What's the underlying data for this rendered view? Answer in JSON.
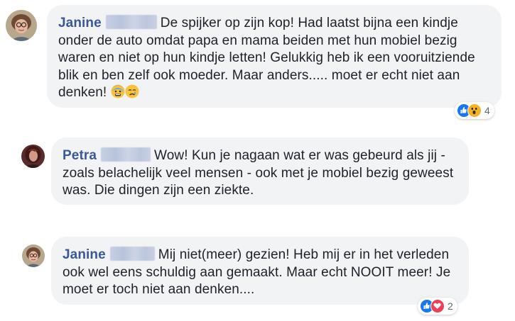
{
  "comments": [
    {
      "author": "Janine",
      "text": "De spijker op zijn kop! Had laatst bijna een kindje onder de auto omdat papa en mama beiden met hun mobiel bezig waren en niet op hun kindje letten! Gelukkig heb ik een vooruitziende blik en ben zelf ook moeder. Maar anders..... moet er echt niet aan denken!",
      "emojis": [
        "anxious-sweat-face-emoji",
        "crying-face-emoji"
      ],
      "reactions": {
        "icons": [
          "like-icon",
          "wow-icon"
        ],
        "count": "4"
      }
    },
    {
      "author": "Petra",
      "text": "Wow! Kun je nagaan wat er was gebeurd als jij - zoals belachelijk veel mensen - ook met je mobiel bezig geweest was. Die dingen zijn een ziekte."
    },
    {
      "author": "Janine",
      "text": "Mij niet(meer) gezien! Heb mij er in het verleden ook wel eens schuldig aan gemaakt. Maar echt NOOIT meer! Je moet er toch niet aan denken....",
      "reactions": {
        "icons": [
          "like-icon",
          "love-icon"
        ],
        "count": "2"
      }
    }
  ],
  "colors": {
    "author_name": "#385898",
    "bubble_bg": "#f2f3f5",
    "text": "#1d2129",
    "like_blue": "#1877f2",
    "love_red": "#f33e58",
    "wow_yellow": "#f7b125"
  }
}
